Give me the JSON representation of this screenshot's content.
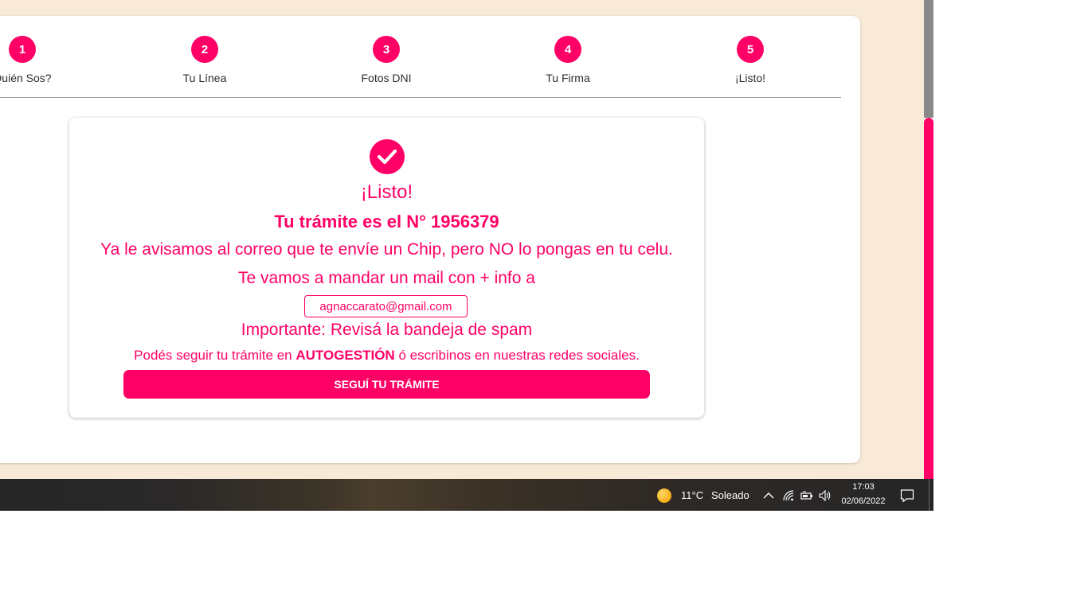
{
  "stepper": {
    "steps": [
      {
        "number": "1",
        "label": "Quién Sos?"
      },
      {
        "number": "2",
        "label": "Tu Línea"
      },
      {
        "number": "3",
        "label": "Fotos DNI"
      },
      {
        "number": "4",
        "label": "Tu Firma"
      },
      {
        "number": "5",
        "label": "¡Listo!"
      }
    ]
  },
  "result": {
    "title": "¡Listo!",
    "tramite": "Tu trámite es el N° 1956379",
    "aviso": "Ya le avisamos al correo que te envíe un Chip, pero NO lo pongas en tu celu.",
    "mail_line": "Te vamos a mandar un mail con + info a",
    "email": "agnaccarato@gmail.com",
    "spam": "Importante: Revisá la bandeja de spam",
    "seguir_prefix": "Podés seguir tu trámite en ",
    "seguir_bold": "AUTOGESTIÓN",
    "seguir_suffix": " ó escribinos en nuestras redes sociales.",
    "button_label": "SEGUÍ TU TRÁMITE"
  },
  "taskbar": {
    "temperature": "11°C",
    "condition": "Soleado",
    "time": "17:03",
    "date": "02/06/2022"
  },
  "icons": {
    "check": "check-circle-icon",
    "weather": "sun-icon",
    "tray": [
      "chevron-up-icon",
      "wifi-icon",
      "battery-icon",
      "volume-icon"
    ],
    "notifications": "notification-icon"
  },
  "colors": {
    "accent": "#ff0066",
    "page_background": "#f8ead7",
    "taskbar": "#262627"
  }
}
